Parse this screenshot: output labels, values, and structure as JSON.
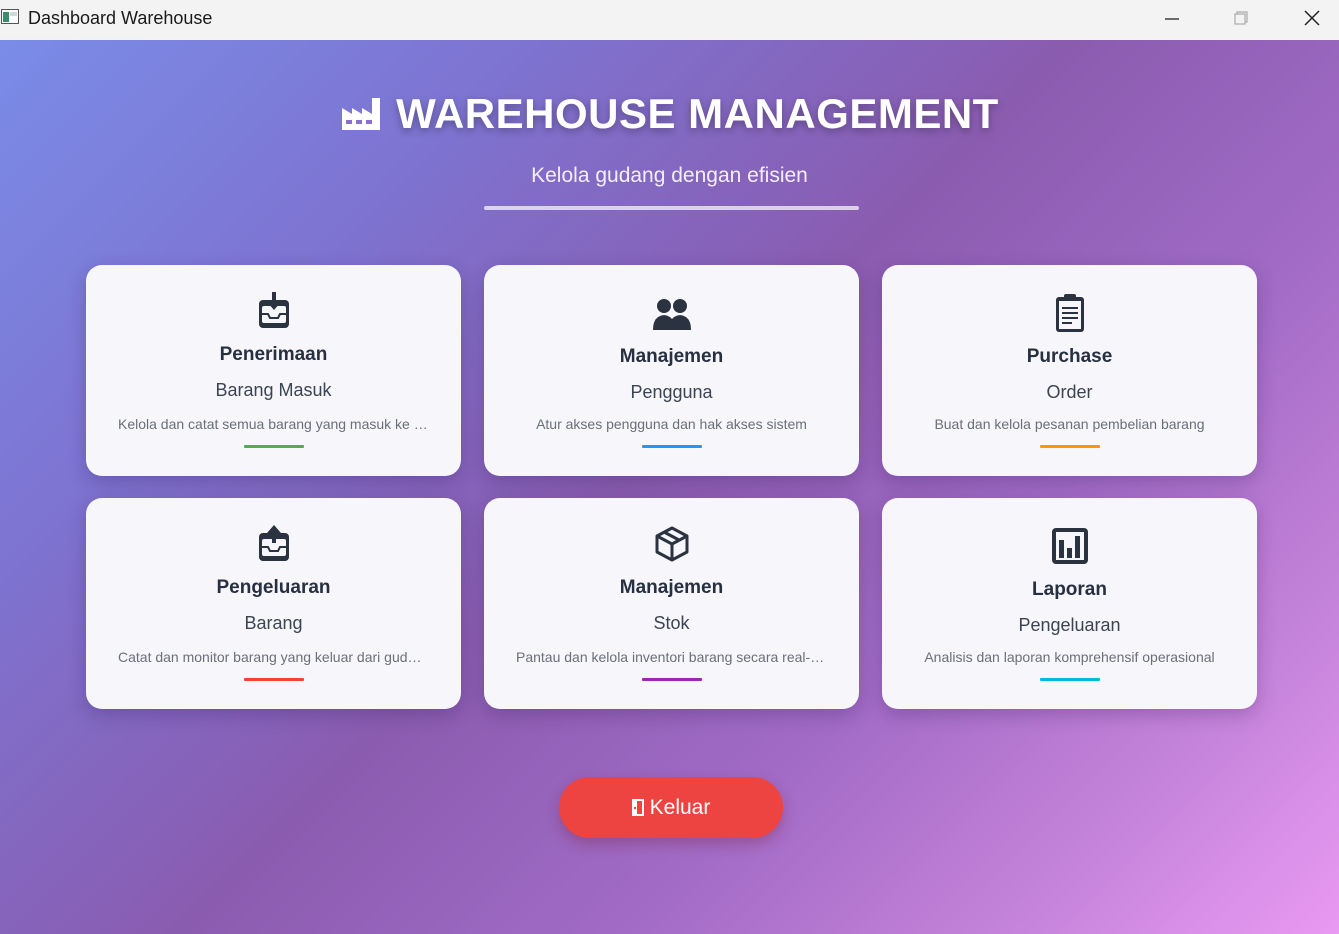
{
  "window": {
    "title": "Dashboard Warehouse",
    "icons": [
      "app-icon",
      "minimize-icon",
      "maximize-icon",
      "close-icon"
    ]
  },
  "header": {
    "title": "WAREHOUSE MANAGEMENT",
    "title_icon": "factory-icon",
    "subtitle": "Kelola gudang dengan efisien"
  },
  "cards": [
    {
      "icon": "inbox-in-icon",
      "title": "Penerimaan",
      "subtitle": "Barang Masuk",
      "description": "Kelola dan catat semua barang yang masuk ke gudang",
      "accent": "#4caf50"
    },
    {
      "icon": "users-icon",
      "title": "Manajemen",
      "subtitle": "Pengguna",
      "description": "Atur akses pengguna dan hak akses sistem",
      "accent": "#2196f3"
    },
    {
      "icon": "clipboard-icon",
      "title": "Purchase",
      "subtitle": "Order",
      "description": "Buat dan kelola pesanan pembelian barang",
      "accent": "#ff9800"
    },
    {
      "icon": "inbox-out-icon",
      "title": "Pengeluaran",
      "subtitle": "Barang",
      "description": "Catat dan monitor barang yang keluar dari gudang",
      "accent": "#f44336"
    },
    {
      "icon": "package-icon",
      "title": "Manajemen",
      "subtitle": "Stok",
      "description": "Pantau dan kelola inventori barang secara real-time",
      "accent": "#9c27b0"
    },
    {
      "icon": "bar-chart-icon",
      "title": "Laporan",
      "subtitle": "Pengeluaran",
      "description": "Analisis dan laporan komprehensif operasional",
      "accent": "#00bcd4"
    }
  ],
  "logout": {
    "label": "Keluar",
    "icon": "door-icon",
    "color": "#ee4441"
  }
}
